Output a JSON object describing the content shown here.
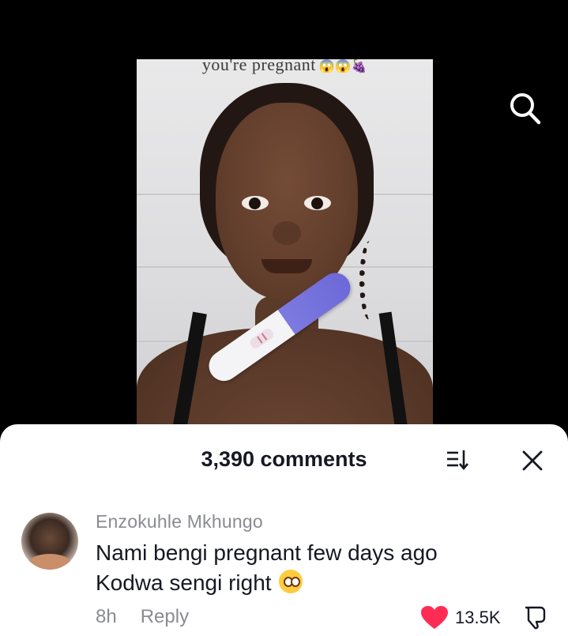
{
  "video": {
    "caption": "you're pregnant",
    "caption_emojis": "😱😱🍇"
  },
  "search": {
    "icon": "search-icon"
  },
  "comments": {
    "count_label": "3,390 comments",
    "sort_icon": "sort-icon",
    "close_icon": "close-icon"
  },
  "comment": {
    "author": "Enzokuhle Mkhungo",
    "text_line1": "Nami bengi pregnant few days ago",
    "text_line2": "Kodwa sengi right",
    "time": "8h",
    "reply_label": "Reply",
    "likes": "13.5K",
    "heart_color": "#fe2c55",
    "liked": true
  }
}
